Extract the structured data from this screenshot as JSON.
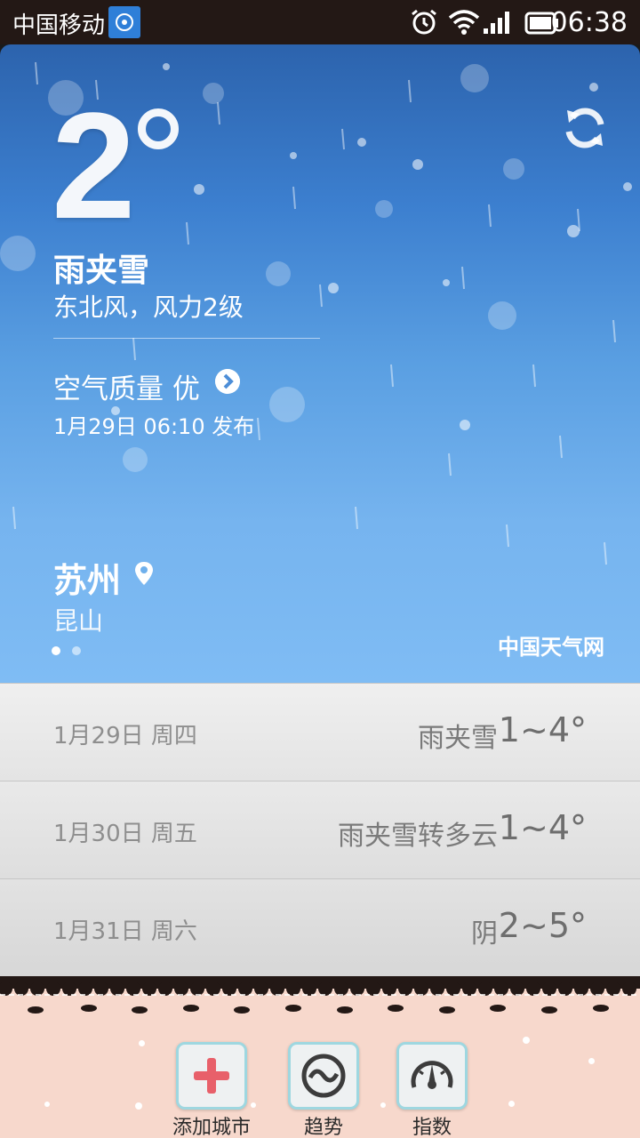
{
  "status_bar": {
    "carrier": "中国移动",
    "time": "06:38"
  },
  "weather": {
    "temperature": "2",
    "condition": "雨夹雪",
    "wind": "东北风，风力2级",
    "air_quality": "空气质量 优",
    "published": "1月29日 06:10 发布",
    "city": "苏州",
    "district": "昆山",
    "brand": "中国天气网",
    "page_count": 2,
    "page_active": 1
  },
  "forecast": [
    {
      "date": "1月29日 周四",
      "condition": "雨夹雪",
      "range": "1~4°"
    },
    {
      "date": "1月30日 周五",
      "condition": "雨夹雪转多云",
      "range": "1~4°"
    },
    {
      "date": "1月31日 周六",
      "condition": "阴",
      "range": "2~5°"
    }
  ],
  "actions": {
    "add_city": "添加城市",
    "trend": "趋势",
    "index": "指数"
  },
  "colors": {
    "accent_red": "#e8606a",
    "hero_top": "#2c63ad",
    "hero_bottom": "#7fbcf4",
    "bottom_bg": "#f7d8cc"
  }
}
